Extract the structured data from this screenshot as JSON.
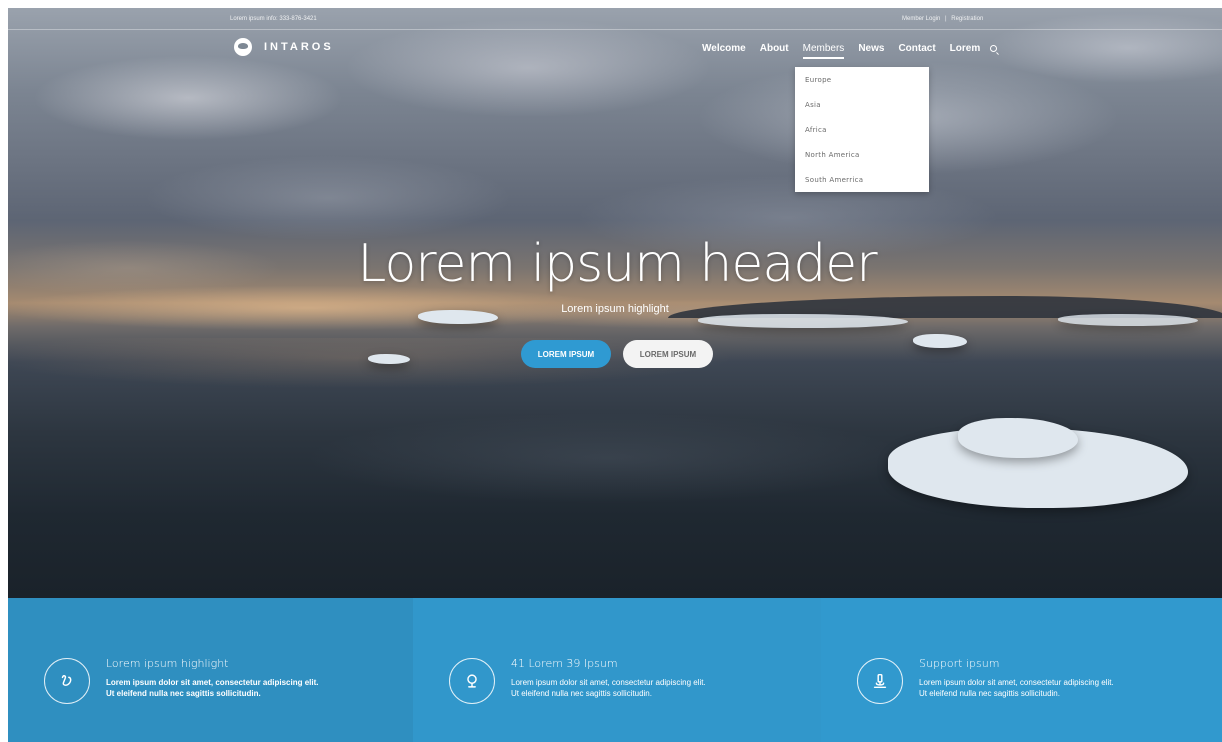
{
  "topbar": {
    "contact": "Lorem ipsum info: 333-876-3421",
    "member_login": "Member Login",
    "separator": "|",
    "registration": "Registration"
  },
  "logo": {
    "name": "INTAROS"
  },
  "nav": {
    "items": [
      {
        "label": "Welcome"
      },
      {
        "label": "About"
      },
      {
        "label": "Members"
      },
      {
        "label": "News"
      },
      {
        "label": "Contact"
      },
      {
        "label": "Lorem"
      }
    ],
    "active": "Members",
    "search_icon": "search-icon"
  },
  "dropdown": {
    "items": [
      "Europe",
      "Asia",
      "Africa",
      "North America",
      "South Amerrica"
    ]
  },
  "hero": {
    "headline": "Lorem ipsum header",
    "subline": "Lorem ipsum highlight",
    "primary_button": "LOREM IPSUM",
    "secondary_button": "LOREM IPSUM"
  },
  "features": [
    {
      "icon": "swirl-icon",
      "title": "Lorem ipsum highlight",
      "line1": "Lorem ipsum dolor sit amet, consectetur adipiscing elit.",
      "line2": "Ut eleifend nulla nec sagittis sollicitudin."
    },
    {
      "icon": "location-pin-icon",
      "title": "41 Lorem 39 Ipsum",
      "line1": "Lorem ipsum dolor sit amet, consectetur adipiscing elit.",
      "line2": "Ut eleifend nulla nec sagittis sollicitudin."
    },
    {
      "icon": "microscope-icon",
      "title": "Support ipsum",
      "line1": "Lorem ipsum dolor sit amet, consectetur adipiscing elit.",
      "line2": "Ut eleifend nulla nec sagittis sollicitudin."
    }
  ],
  "colors": {
    "accent": "#2f9ad2",
    "feature_bg_1": "#2f8fc0",
    "feature_bg_2": "#3197cb",
    "feature_bg_3": "#3199ce"
  }
}
